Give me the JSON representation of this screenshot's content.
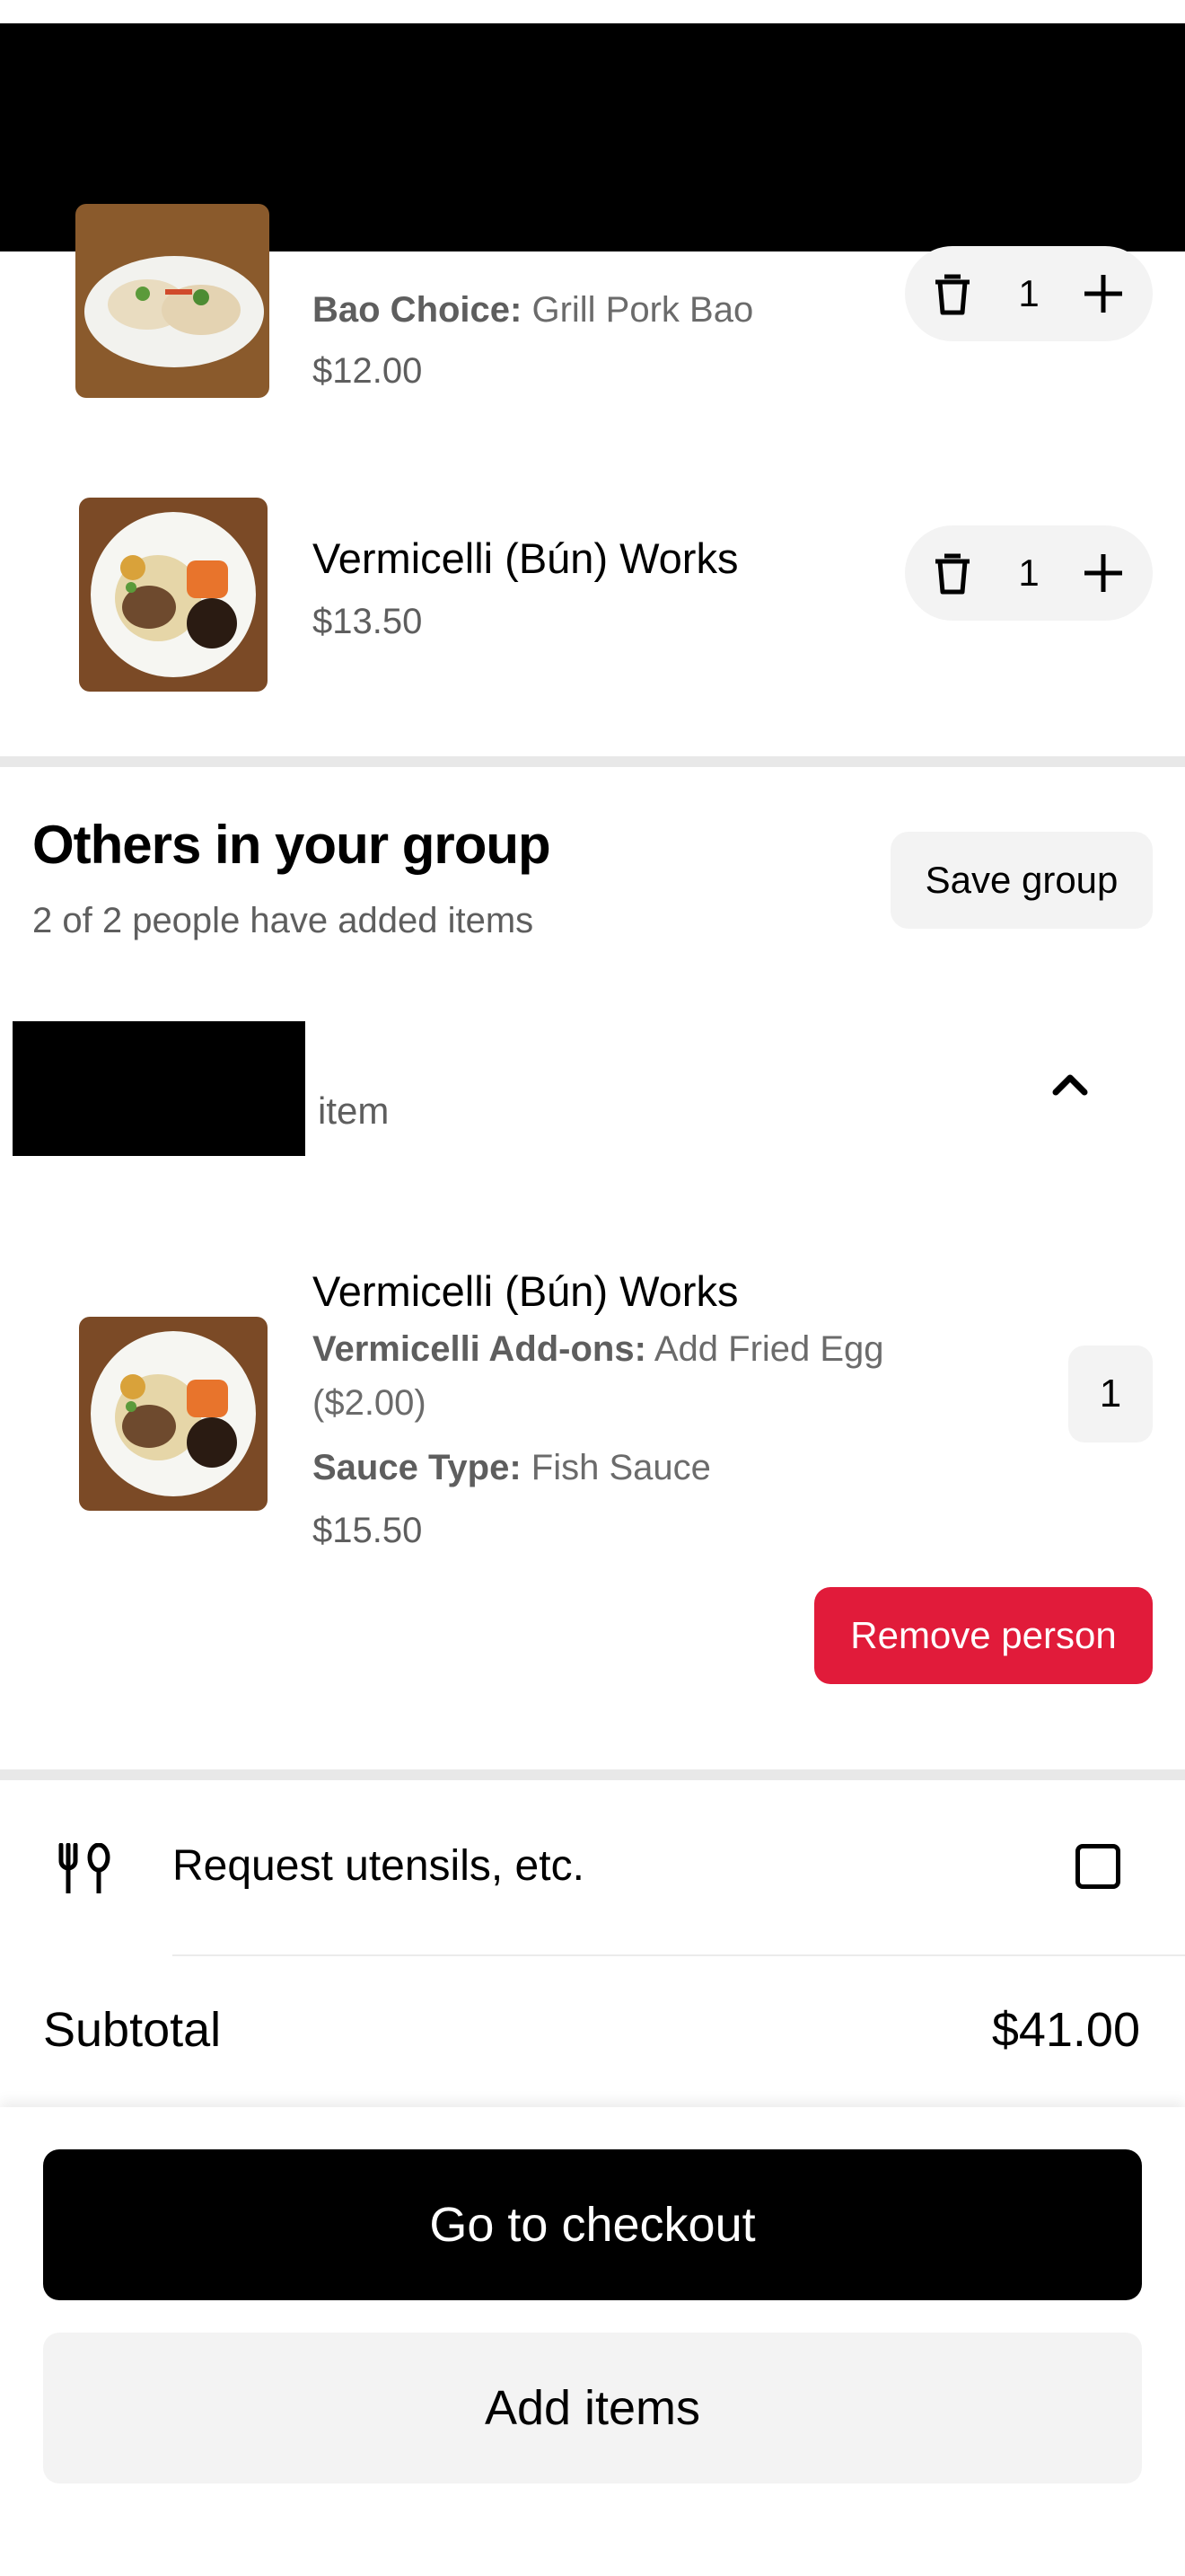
{
  "cart": {
    "items": [
      {
        "option_label": "Bao Choice:",
        "option_value": " Grill Pork Bao",
        "price": "$12.00",
        "quantity": "1",
        "image_icon": "bao-food-photo"
      },
      {
        "title": "Vermicelli (Bún) Works",
        "price": "$13.50",
        "quantity": "1",
        "image_icon": "vermicelli-food-photo"
      }
    ]
  },
  "group": {
    "title": "Others in your group",
    "subtitle": "2 of 2 people have added items",
    "save_button": "Save group",
    "person": {
      "item_count_text": " item",
      "item": {
        "title": "Vermicelli (Bún) Works",
        "option1_label": "Vermicelli Add-ons:",
        "option1_value": " Add Fried Egg",
        "option1_value_cont": "($2.00)",
        "option2_label": "Sauce Type:",
        "option2_value": " Fish Sauce",
        "price": "$15.50",
        "quantity": "1"
      },
      "remove_button": "Remove person"
    }
  },
  "utensils": {
    "label": "Request utensils, etc.",
    "checked": false,
    "icon": "utensils-icon"
  },
  "summary": {
    "subtotal_label": "Subtotal",
    "subtotal_value": "$41.00"
  },
  "actions": {
    "checkout": "Go to checkout",
    "add_items": "Add items"
  },
  "colors": {
    "remove_red": "#e11b3a",
    "pill_gray": "#f3f3f3",
    "muted_text": "#5e5e5e"
  }
}
